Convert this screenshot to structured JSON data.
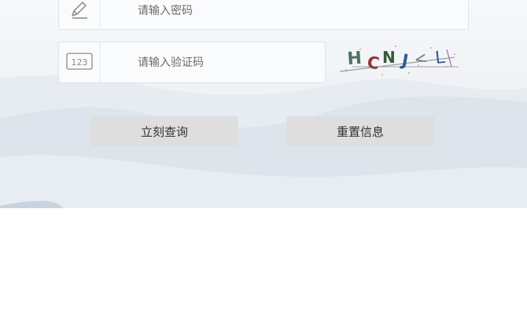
{
  "form": {
    "password": {
      "placeholder": "请输入密码",
      "icon": "pencil-icon"
    },
    "captcha": {
      "placeholder": "请输入验证码",
      "icon": "numeric-123-icon",
      "icon_text": "123",
      "image_text": "HCNJ<L"
    }
  },
  "buttons": {
    "query_label": "立刻查询",
    "reset_label": "重置信息"
  },
  "colors": {
    "button_bg": "#dedede",
    "field_border": "#dfe3e8",
    "background_mountains": "#dde4ec"
  }
}
